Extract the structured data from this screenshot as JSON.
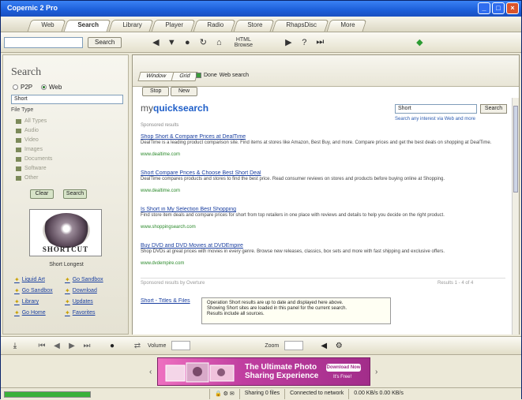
{
  "window": {
    "title": "Copernic 2 Pro"
  },
  "tabs": [
    "Web",
    "Search",
    "Library",
    "Player",
    "Radio",
    "Store",
    "RhapsDisc",
    "More"
  ],
  "toolbar": {
    "address_value": "",
    "search_button": "Search",
    "html_label_line1": "HTML",
    "html_label_line2": "Browse"
  },
  "sidebar": {
    "title": "Search",
    "radio_p2p": "P2P",
    "radio_web": "Web",
    "query_value": "Short",
    "type_label": "File Type",
    "options": [
      "All Types",
      "Audio",
      "Video",
      "Images",
      "Documents",
      "Software",
      "Other"
    ],
    "btn_clear": "Clear",
    "btn_search": "Search",
    "logo_text": "SHORTCUT",
    "caption": "Short Longest",
    "links": [
      [
        "Liquid Art",
        "Go Sandbox"
      ],
      [
        "Go Sandbox",
        "Download"
      ],
      [
        "Library",
        "Updates"
      ],
      [
        "Go Home",
        "Favorites"
      ]
    ]
  },
  "main": {
    "tab_window": "Window",
    "tab_grid": "Grid",
    "check_label": "Done",
    "check_value": "Web search",
    "btn_stop": "Stop",
    "btn_new": "New"
  },
  "web": {
    "brand_prefix": "my",
    "brand_name": "quicksearch",
    "query_value": "Short",
    "query_button": "Search",
    "note": "Search any interest via Web and more",
    "subheading": "Sponsored results",
    "results": [
      {
        "title": "Shop Short & Compare Prices at DealTime",
        "desc": "DealTime is a leading product comparison site. Find items at stores like Amazon, Best Buy, and more. Compare prices and get the best deals on shopping at DealTime.",
        "url": "www.dealtime.com"
      },
      {
        "title": "Short Compare Prices & Choose Best Short Deal",
        "desc": "DealTime compares products and stores to find the best price. Read consumer reviews on stores and products before buying online at Shopping.",
        "url": "www.dealtime.com"
      },
      {
        "title": "Is Short in My Selection Best Shopping",
        "desc": "Find store item deals and compare prices for short from top retailers in one place with reviews and details to help you decide on the right product.",
        "url": "www.shoppingsearch.com"
      },
      {
        "title": "Buy DVD and DVD Movies at DVDEmpire",
        "desc": "Shop DVDs at great prices with movies in every genre. Browse new releases, classics, box sets and more with fast shipping and exclusive offers.",
        "url": "www.dvdempire.com"
      }
    ],
    "footer_left": "Sponsored results by Overture",
    "footer_right": "Results 1 - 4 of 4",
    "extra_link": "Short - Titles & Files"
  },
  "overlay": {
    "line1": "Operation Short results are up to date and displayed here above.",
    "line2": "Showing Short sites are loaded in this panel for the current search.",
    "line3": "Results include all sources."
  },
  "bottombar": {
    "volume_label": "Volume",
    "zoom_label": "Zoom"
  },
  "ad": {
    "line1": "The Ultimate Photo",
    "line2": "Sharing Experience",
    "button": "Download Now",
    "sub": "It's Free!"
  },
  "statusbar": {
    "cell1": "",
    "cell2": "Sharing 0 files",
    "cell3": "Connected to network",
    "cell4": "0.00 KB/s 0.00 KB/s"
  }
}
